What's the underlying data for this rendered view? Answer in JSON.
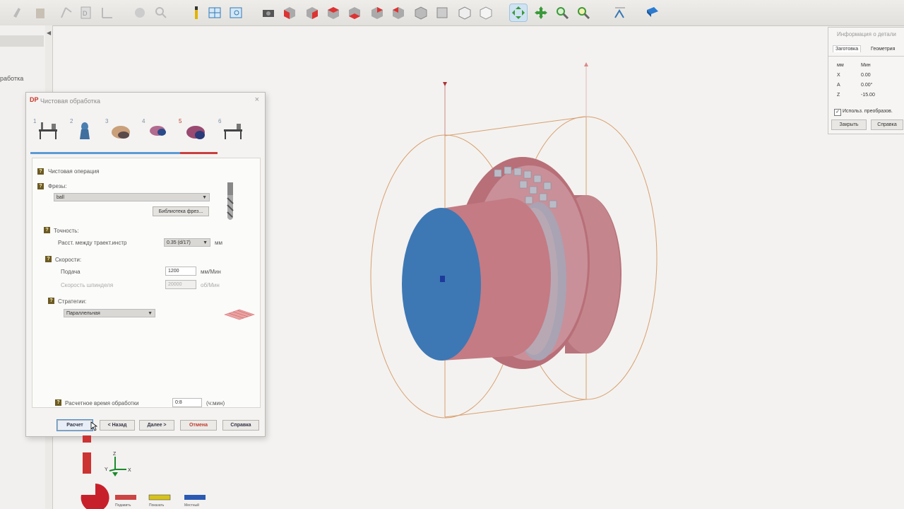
{
  "toolbar": {
    "icons": [
      "cut-icon",
      "fixture-icon",
      "stock-icon",
      "wcs-icon",
      "document-icon",
      "sphere-icon",
      "magnify-icon",
      "tool-icon",
      "grid-icon",
      "zoom-window-icon",
      "camera-icon",
      "view-front-icon",
      "view-back-icon",
      "view-left-icon",
      "view-right-icon",
      "view-top-icon",
      "view-bottom-icon",
      "view-iso1-icon",
      "view-iso2-icon",
      "view-iso3-icon",
      "view-iso4-icon",
      "rotate-icon",
      "pan-icon",
      "zoom-icon",
      "zoom-fit-icon",
      "measure-icon",
      "book-icon"
    ]
  },
  "left_panel": {
    "label": "работка"
  },
  "dialog": {
    "logo": "DP",
    "title": "Чистовая обработка",
    "close": "×",
    "steps": [
      "1",
      "2",
      "3",
      "4",
      "5",
      "6"
    ],
    "current_step": 5,
    "section_finish": "Чистовая операция",
    "cutter_label": "Фрезы:",
    "cutter_value": "ball",
    "cutter_library_btn": "Библиотека фрез...",
    "accuracy_label": "Точность:",
    "stepover_label": "Расст. между траект.инстр",
    "stepover_value": "0.35 (d/17)",
    "stepover_unit": "мм",
    "speed_label": "Скорости:",
    "feed_label": "Подача",
    "feed_value": "1200",
    "feed_unit": "мм/Мин",
    "spindle_label": "Скорость шпинделя",
    "spindle_value": "20000",
    "spindle_unit": "об/Мин",
    "strategy_label": "Стратегии:",
    "strategy_value": "Параллельная",
    "est_time_label": "Расчетное время обработки",
    "est_time_value": "0:8",
    "est_time_unit": "(ч:мин)",
    "buttons": {
      "calc": "Расчет",
      "back": "< Назад",
      "next": "Далее >",
      "cancel": "Отмена",
      "help": "Справка"
    },
    "help_mark": "?"
  },
  "info_panel": {
    "title": "Информация о детали",
    "tabs": [
      "Заготовка",
      "Геометрия"
    ],
    "col_unit": "мм",
    "col_min": "Мин",
    "rows": [
      {
        "axis": "X",
        "min": "0.00"
      },
      {
        "axis": "A",
        "min": "0.00°"
      },
      {
        "axis": "Z",
        "min": "-15.00"
      }
    ],
    "checkbox": "Использ. преобразов.",
    "close_btn": "Закрыть",
    "help_btn": "Справка"
  },
  "axes": {
    "x": "X",
    "y": "Y",
    "z": "Z"
  },
  "bottom_labels": [
    "Подавить",
    "Показать",
    "Местный"
  ],
  "colors": {
    "part_body": "#c98a8a",
    "part_face": "#3d78b4",
    "bbox": "#d99a6a",
    "accent_blue": "#5d9ad6",
    "accent_red": "#c84040"
  }
}
